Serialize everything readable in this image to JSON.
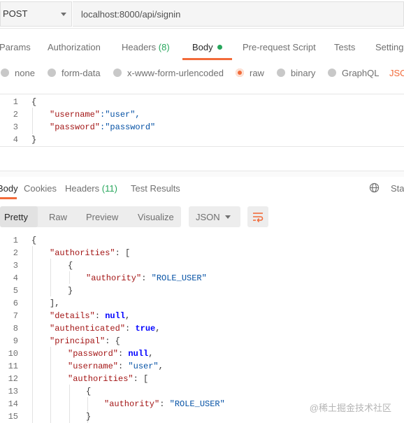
{
  "request": {
    "method": "POST",
    "url": "localhost:8000/api/signin",
    "tabs": {
      "params": "Params",
      "authorization": "Authorization",
      "headers": "Headers",
      "headers_count": "(8)",
      "body": "Body",
      "pre_request": "Pre-request Script",
      "tests": "Tests",
      "settings": "Settings"
    },
    "body_types": {
      "none": "none",
      "form_data": "form-data",
      "urlencoded": "x-www-form-urlencoded",
      "raw": "raw",
      "binary": "binary",
      "graphql": "GraphQL",
      "json": "JSON"
    },
    "editor": {
      "line_numbers": [
        "1",
        "2",
        "3",
        "4"
      ],
      "l1": "{",
      "l2_key": "\"username\"",
      "l2_rest": ":\"user\",",
      "l3_key": "\"password\"",
      "l3_rest": ":\"password\"",
      "l4": "}"
    }
  },
  "response": {
    "tabs": {
      "body": "Body",
      "cookies": "Cookies",
      "headers": "Headers",
      "headers_count": "(11)",
      "test_results": "Test Results",
      "status": "Status"
    },
    "views": {
      "pretty": "Pretty",
      "raw": "Raw",
      "preview": "Preview",
      "visualize": "Visualize"
    },
    "format": "JSON",
    "line_numbers": [
      "1",
      "2",
      "3",
      "4",
      "5",
      "6",
      "7",
      "8",
      "9",
      "10",
      "11",
      "12",
      "13",
      "14",
      "15"
    ],
    "code": {
      "l1": "{",
      "l2_key": "\"authorities\"",
      "l2_rest": ": [",
      "l3": "{",
      "l4_key": "\"authority\"",
      "l4_colon": ": ",
      "l4_val": "\"ROLE_USER\"",
      "l5": "}",
      "l6": "],",
      "l7_key": "\"details\"",
      "l7_colon": ": ",
      "l7_val": "null",
      "l7_end": ",",
      "l8_key": "\"authenticated\"",
      "l8_colon": ": ",
      "l8_val": "true",
      "l8_end": ",",
      "l9_key": "\"principal\"",
      "l9_rest": ": {",
      "l10_key": "\"password\"",
      "l10_colon": ": ",
      "l10_val": "null",
      "l10_end": ",",
      "l11_key": "\"username\"",
      "l11_colon": ": ",
      "l11_val": "\"user\"",
      "l11_end": ",",
      "l12_key": "\"authorities\"",
      "l12_rest": ": [",
      "l13": "{",
      "l14_key": "\"authority\"",
      "l14_colon": ": ",
      "l14_val": "\"ROLE_USER\"",
      "l15": "}"
    }
  },
  "watermark": "@稀土掘金技术社区",
  "colors": {
    "accent": "#f26b3a",
    "count_green": "#26a65b",
    "json_key": "#a31515",
    "json_string": "#0451a5",
    "json_keyword": "#0000ff"
  },
  "icons": {
    "method_dropdown": "chevron-down-icon",
    "globe": "globe-icon",
    "wrap": "wrap-lines-icon"
  }
}
